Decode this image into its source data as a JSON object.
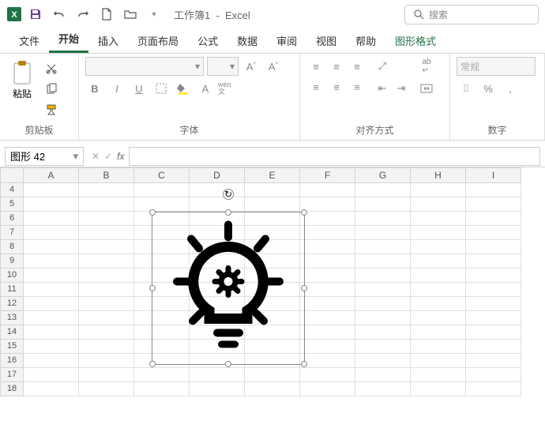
{
  "title": {
    "doc": "工作簿1",
    "app": "Excel"
  },
  "search": {
    "placeholder": "搜索"
  },
  "tabs": {
    "file": "文件",
    "home": "开始",
    "insert": "插入",
    "layout": "页面布局",
    "formula": "公式",
    "data": "数据",
    "review": "审阅",
    "view": "视图",
    "help": "帮助",
    "shapeformat": "图形格式"
  },
  "ribbon": {
    "clipboard": {
      "paste": "粘贴",
      "label": "剪贴板"
    },
    "font": {
      "label": "字体",
      "bold": "B",
      "italic": "I",
      "underline": "U",
      "wen": "wén 文"
    },
    "alignment": {
      "label": "对齐方式"
    },
    "number": {
      "label": "数字",
      "general": "常规"
    }
  },
  "namebox": "图形 42",
  "fx": "fx",
  "columns": [
    "A",
    "B",
    "C",
    "D",
    "E",
    "F",
    "G",
    "H",
    "I"
  ],
  "rows": [
    "4",
    "5",
    "6",
    "7",
    "8",
    "9",
    "10",
    "11",
    "12",
    "13",
    "14",
    "15",
    "16",
    "17",
    "18"
  ]
}
